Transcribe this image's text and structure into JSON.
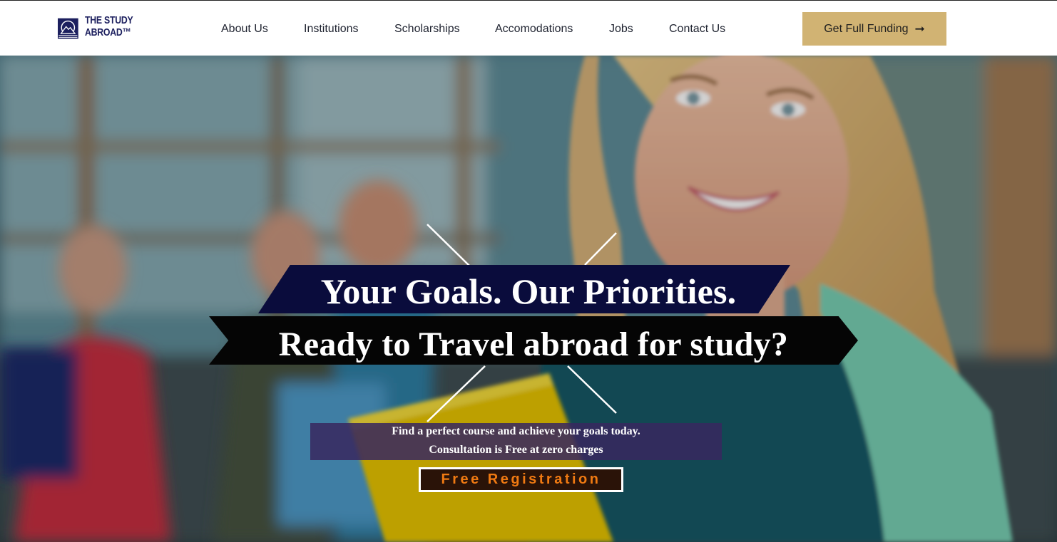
{
  "brand": {
    "name_line1": "THE STUDY",
    "name_line2": "ABROAD™",
    "logo_color": "#1c1f5e"
  },
  "nav": {
    "items": [
      {
        "label": "About Us"
      },
      {
        "label": "Institutions"
      },
      {
        "label": "Scholarships"
      },
      {
        "label": "Accomodations"
      },
      {
        "label": "Jobs"
      },
      {
        "label": "Contact Us"
      }
    ]
  },
  "cta": {
    "label": "Get Full Funding",
    "icon": "arrow-right-icon",
    "color": "#d1b373"
  },
  "hero": {
    "headline_1": "Your Goals. Our Priorities.",
    "headline_2": "Ready to Travel abroad for study?",
    "subtext_1": "Find a perfect course and achieve your goals today.",
    "subtext_2": "Consultation is Free at zero charges",
    "register_label": "Free Registration",
    "register_color": "#f07a12"
  }
}
